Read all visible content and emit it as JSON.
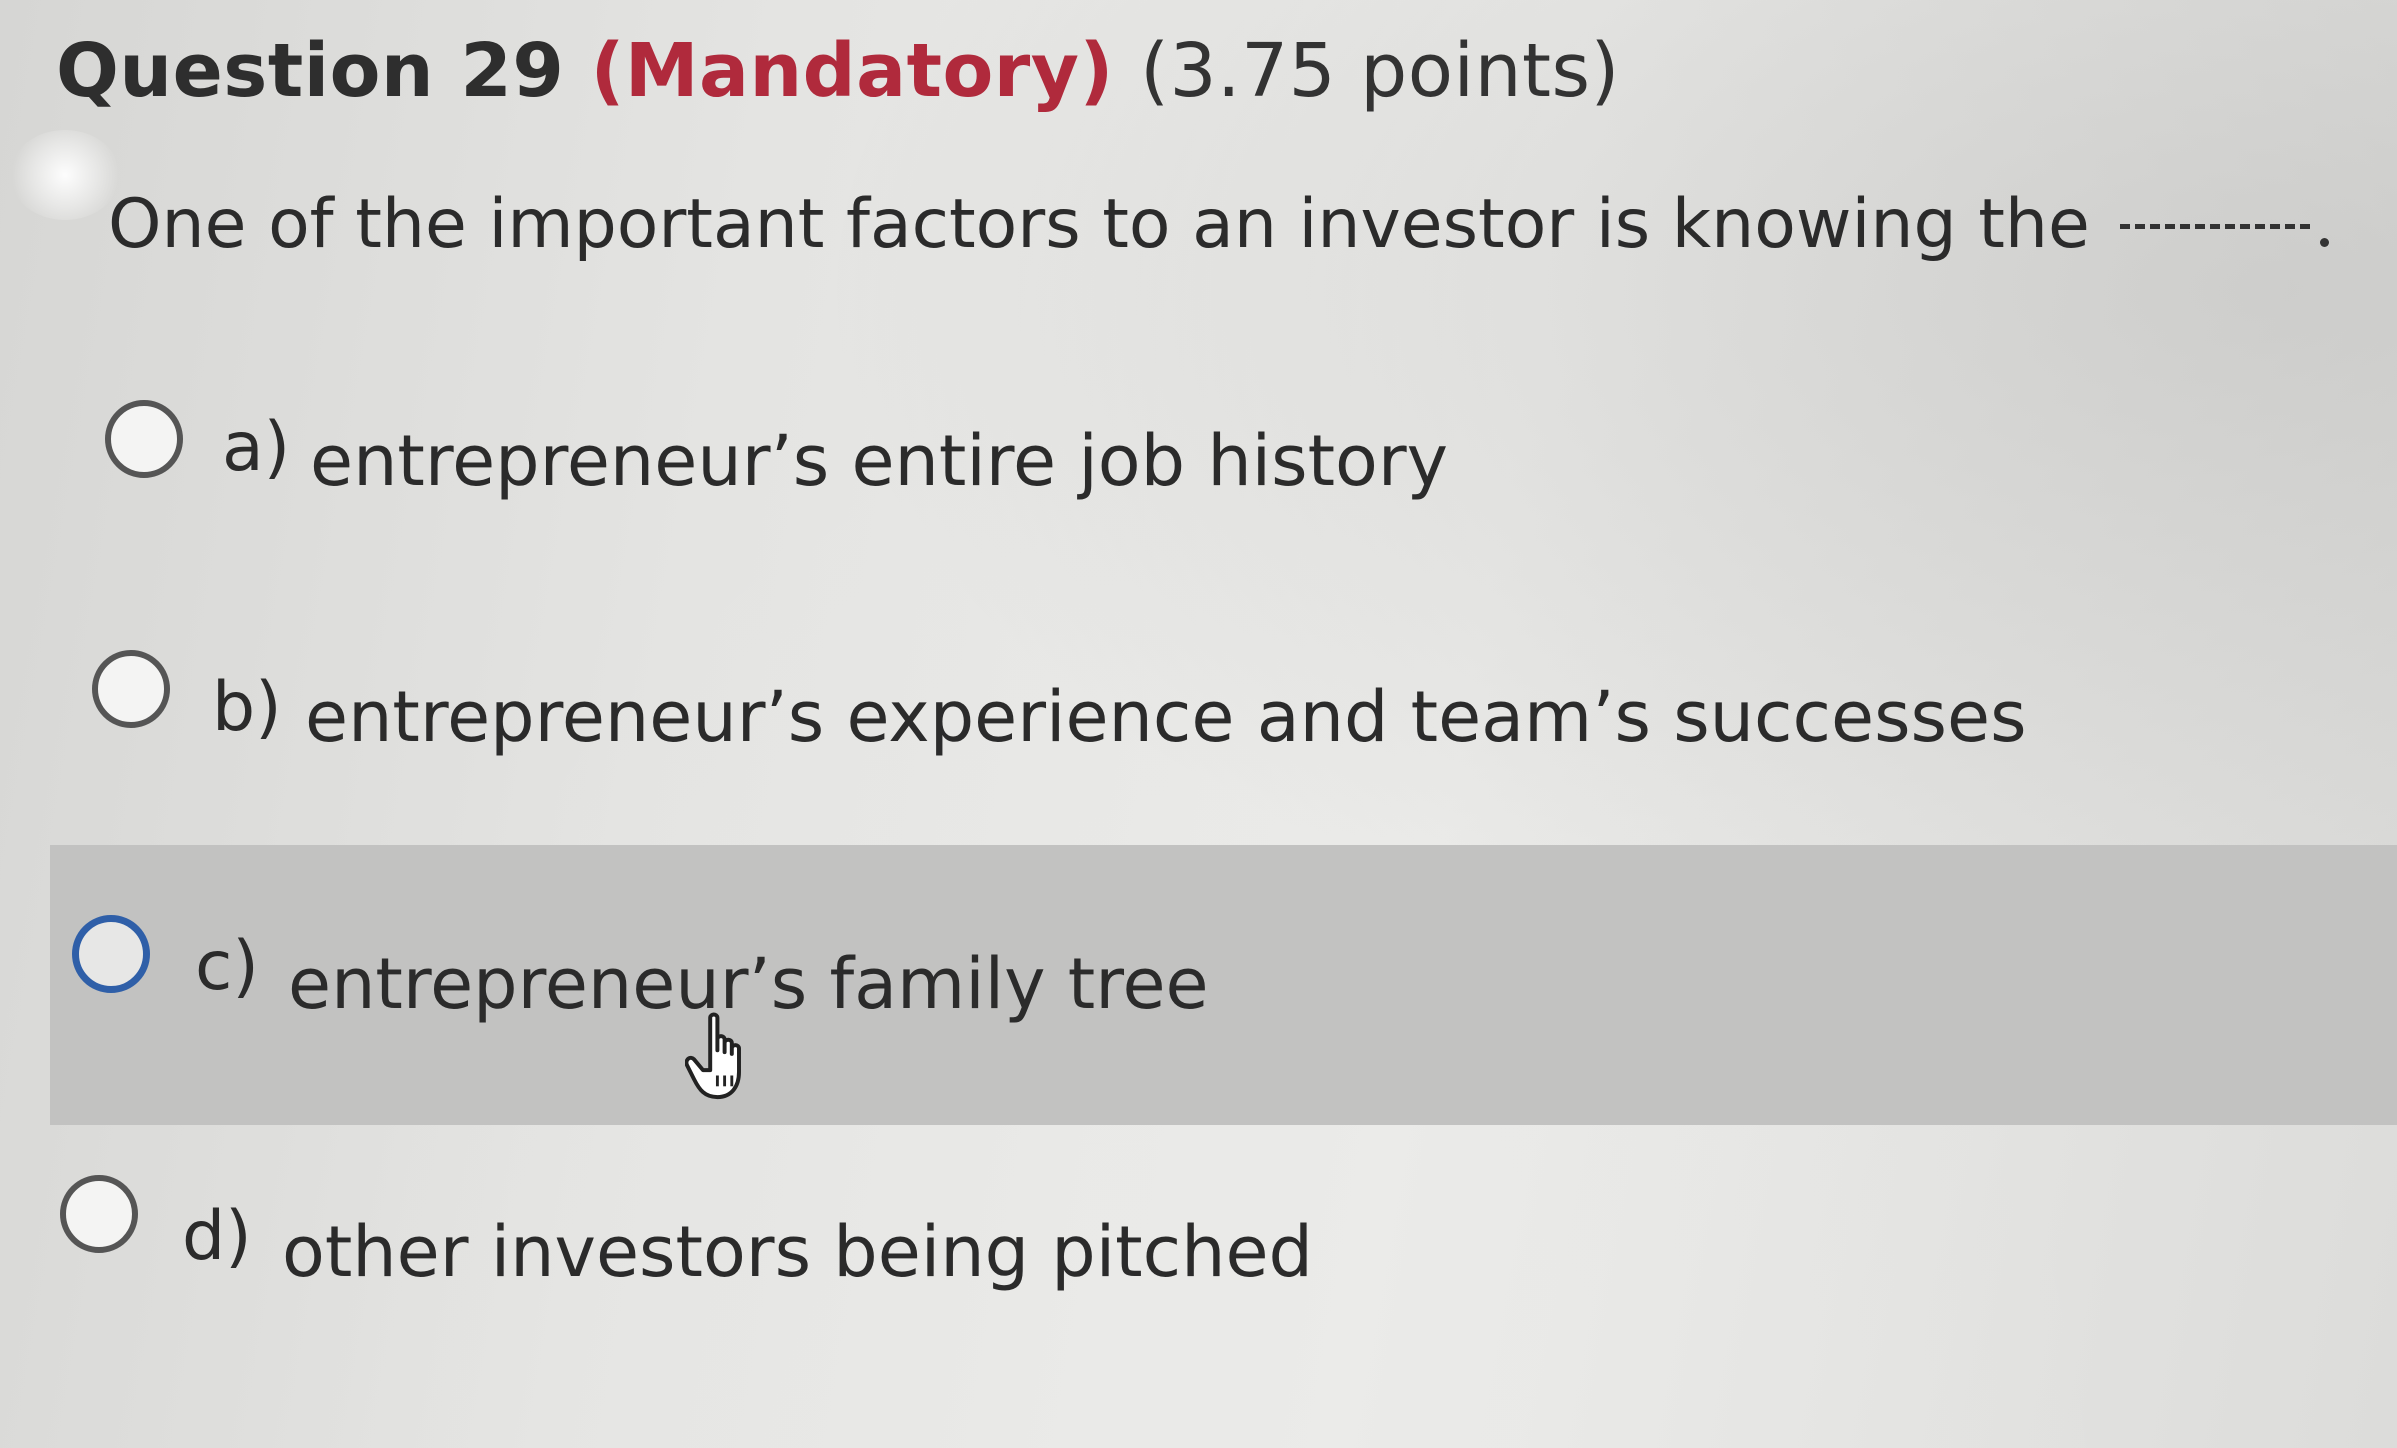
{
  "question": {
    "number_label": "Question 29",
    "mandatory_label": "(Mandatory)",
    "points_label": "(3.75 points)",
    "prompt": "One of the important factors to an investor is knowing the",
    "blank_icon": "dashed-blank"
  },
  "options": [
    {
      "letter": "a)",
      "text": "entrepreneur’s entire job history",
      "selected": false
    },
    {
      "letter": "b)",
      "text": "entrepreneur’s experience and team’s successes",
      "selected": false
    },
    {
      "letter": "c)",
      "text": "entrepreneur’s family tree",
      "selected": false,
      "hovered": true
    },
    {
      "letter": "d)",
      "text": "other investors being pitched",
      "selected": false
    }
  ],
  "colors": {
    "mandatory": "#b02a3c",
    "hover_band": "#c2c2c1",
    "hover_radio": "#2f5fa8"
  },
  "cursor_icon": "hand-pointer-icon"
}
